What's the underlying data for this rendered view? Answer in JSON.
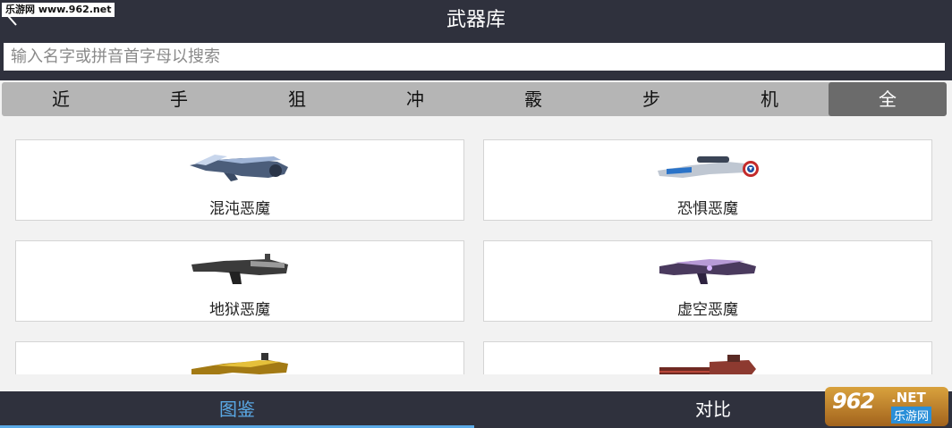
{
  "header": {
    "title": "武器库",
    "watermark": "乐游网 www.962.net"
  },
  "search": {
    "placeholder": "输入名字或拼音首字母以搜索",
    "value": ""
  },
  "tabs": [
    {
      "label": "近",
      "active": false
    },
    {
      "label": "手",
      "active": false
    },
    {
      "label": "狙",
      "active": false
    },
    {
      "label": "冲",
      "active": false
    },
    {
      "label": "霰",
      "active": false
    },
    {
      "label": "步",
      "active": false
    },
    {
      "label": "机",
      "active": false
    },
    {
      "label": "全",
      "active": true
    }
  ],
  "weapons": [
    {
      "name": "混沌恶魔",
      "icon": "rifle-blue-gun-icon"
    },
    {
      "name": "恐惧恶魔",
      "icon": "sniper-captain-gun-icon"
    },
    {
      "name": "地狱恶魔",
      "icon": "rifle-black-gun-icon"
    },
    {
      "name": "虚空恶魔",
      "icon": "rifle-purple-gun-icon"
    },
    {
      "name": "",
      "icon": "rifle-gold-gun-icon"
    },
    {
      "name": "",
      "icon": "minigun-red-gun-icon"
    }
  ],
  "bottom_nav": {
    "left": "图鉴",
    "right": "对比"
  },
  "logo": {
    "number": "962",
    "suffix": ".NET",
    "cn": "乐游网"
  },
  "colors": {
    "header_bg": "#2f313d",
    "tab_bar_bg": "#b5b5b5",
    "tab_active_bg": "#6b6b6b",
    "bottom_active": "#5aa9e6"
  }
}
